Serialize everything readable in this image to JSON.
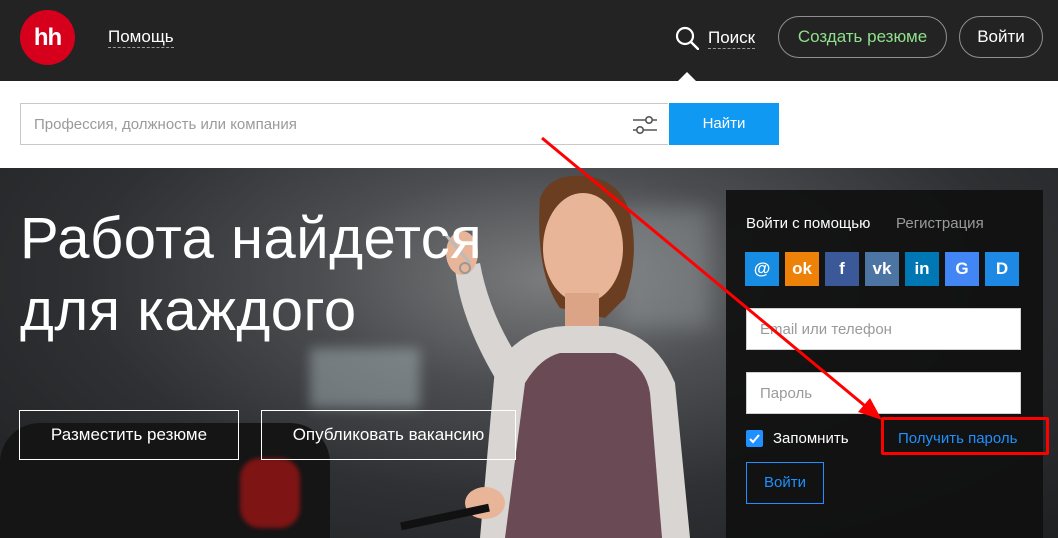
{
  "header": {
    "logo_text": "hh",
    "help_label": "Помощь",
    "search_label": "Поиск",
    "create_resume_label": "Создать резюме",
    "login_label": "Войти"
  },
  "search": {
    "placeholder": "Профессия, должность или компания",
    "button_label": "Найти"
  },
  "hero": {
    "title_line1": "Работа найдется",
    "title_line2": "для каждого",
    "post_resume_label": "Разместить резюме",
    "publish_vacancy_label": "Опубликовать вакансию"
  },
  "login_panel": {
    "tab_login_with": "Войти с помощью",
    "tab_register": "Регистрация",
    "socials": [
      {
        "name": "mail-icon",
        "glyph": "@",
        "color": "#168de2"
      },
      {
        "name": "odnoklassniki-icon",
        "glyph": "ok",
        "color": "#ee8208"
      },
      {
        "name": "facebook-icon",
        "glyph": "f",
        "color": "#3b5998"
      },
      {
        "name": "vk-icon",
        "glyph": "vk",
        "color": "#4c75a3"
      },
      {
        "name": "linkedin-icon",
        "glyph": "in",
        "color": "#0077b5"
      },
      {
        "name": "google-icon",
        "glyph": "G",
        "color": "#4285f4"
      },
      {
        "name": "d-icon",
        "glyph": "D",
        "color": "#1e88e5"
      }
    ],
    "email_placeholder": "Email или телефон",
    "password_placeholder": "Пароль",
    "remember_label": "Запомнить",
    "get_password_label": "Получить пароль",
    "login_button_label": "Войти"
  },
  "colors": {
    "header_bg": "#232323",
    "brand_red": "#d6001c",
    "resume_green": "#8fe08b",
    "accent_blue": "#0f99f2",
    "annotation_red": "#ff0000"
  }
}
